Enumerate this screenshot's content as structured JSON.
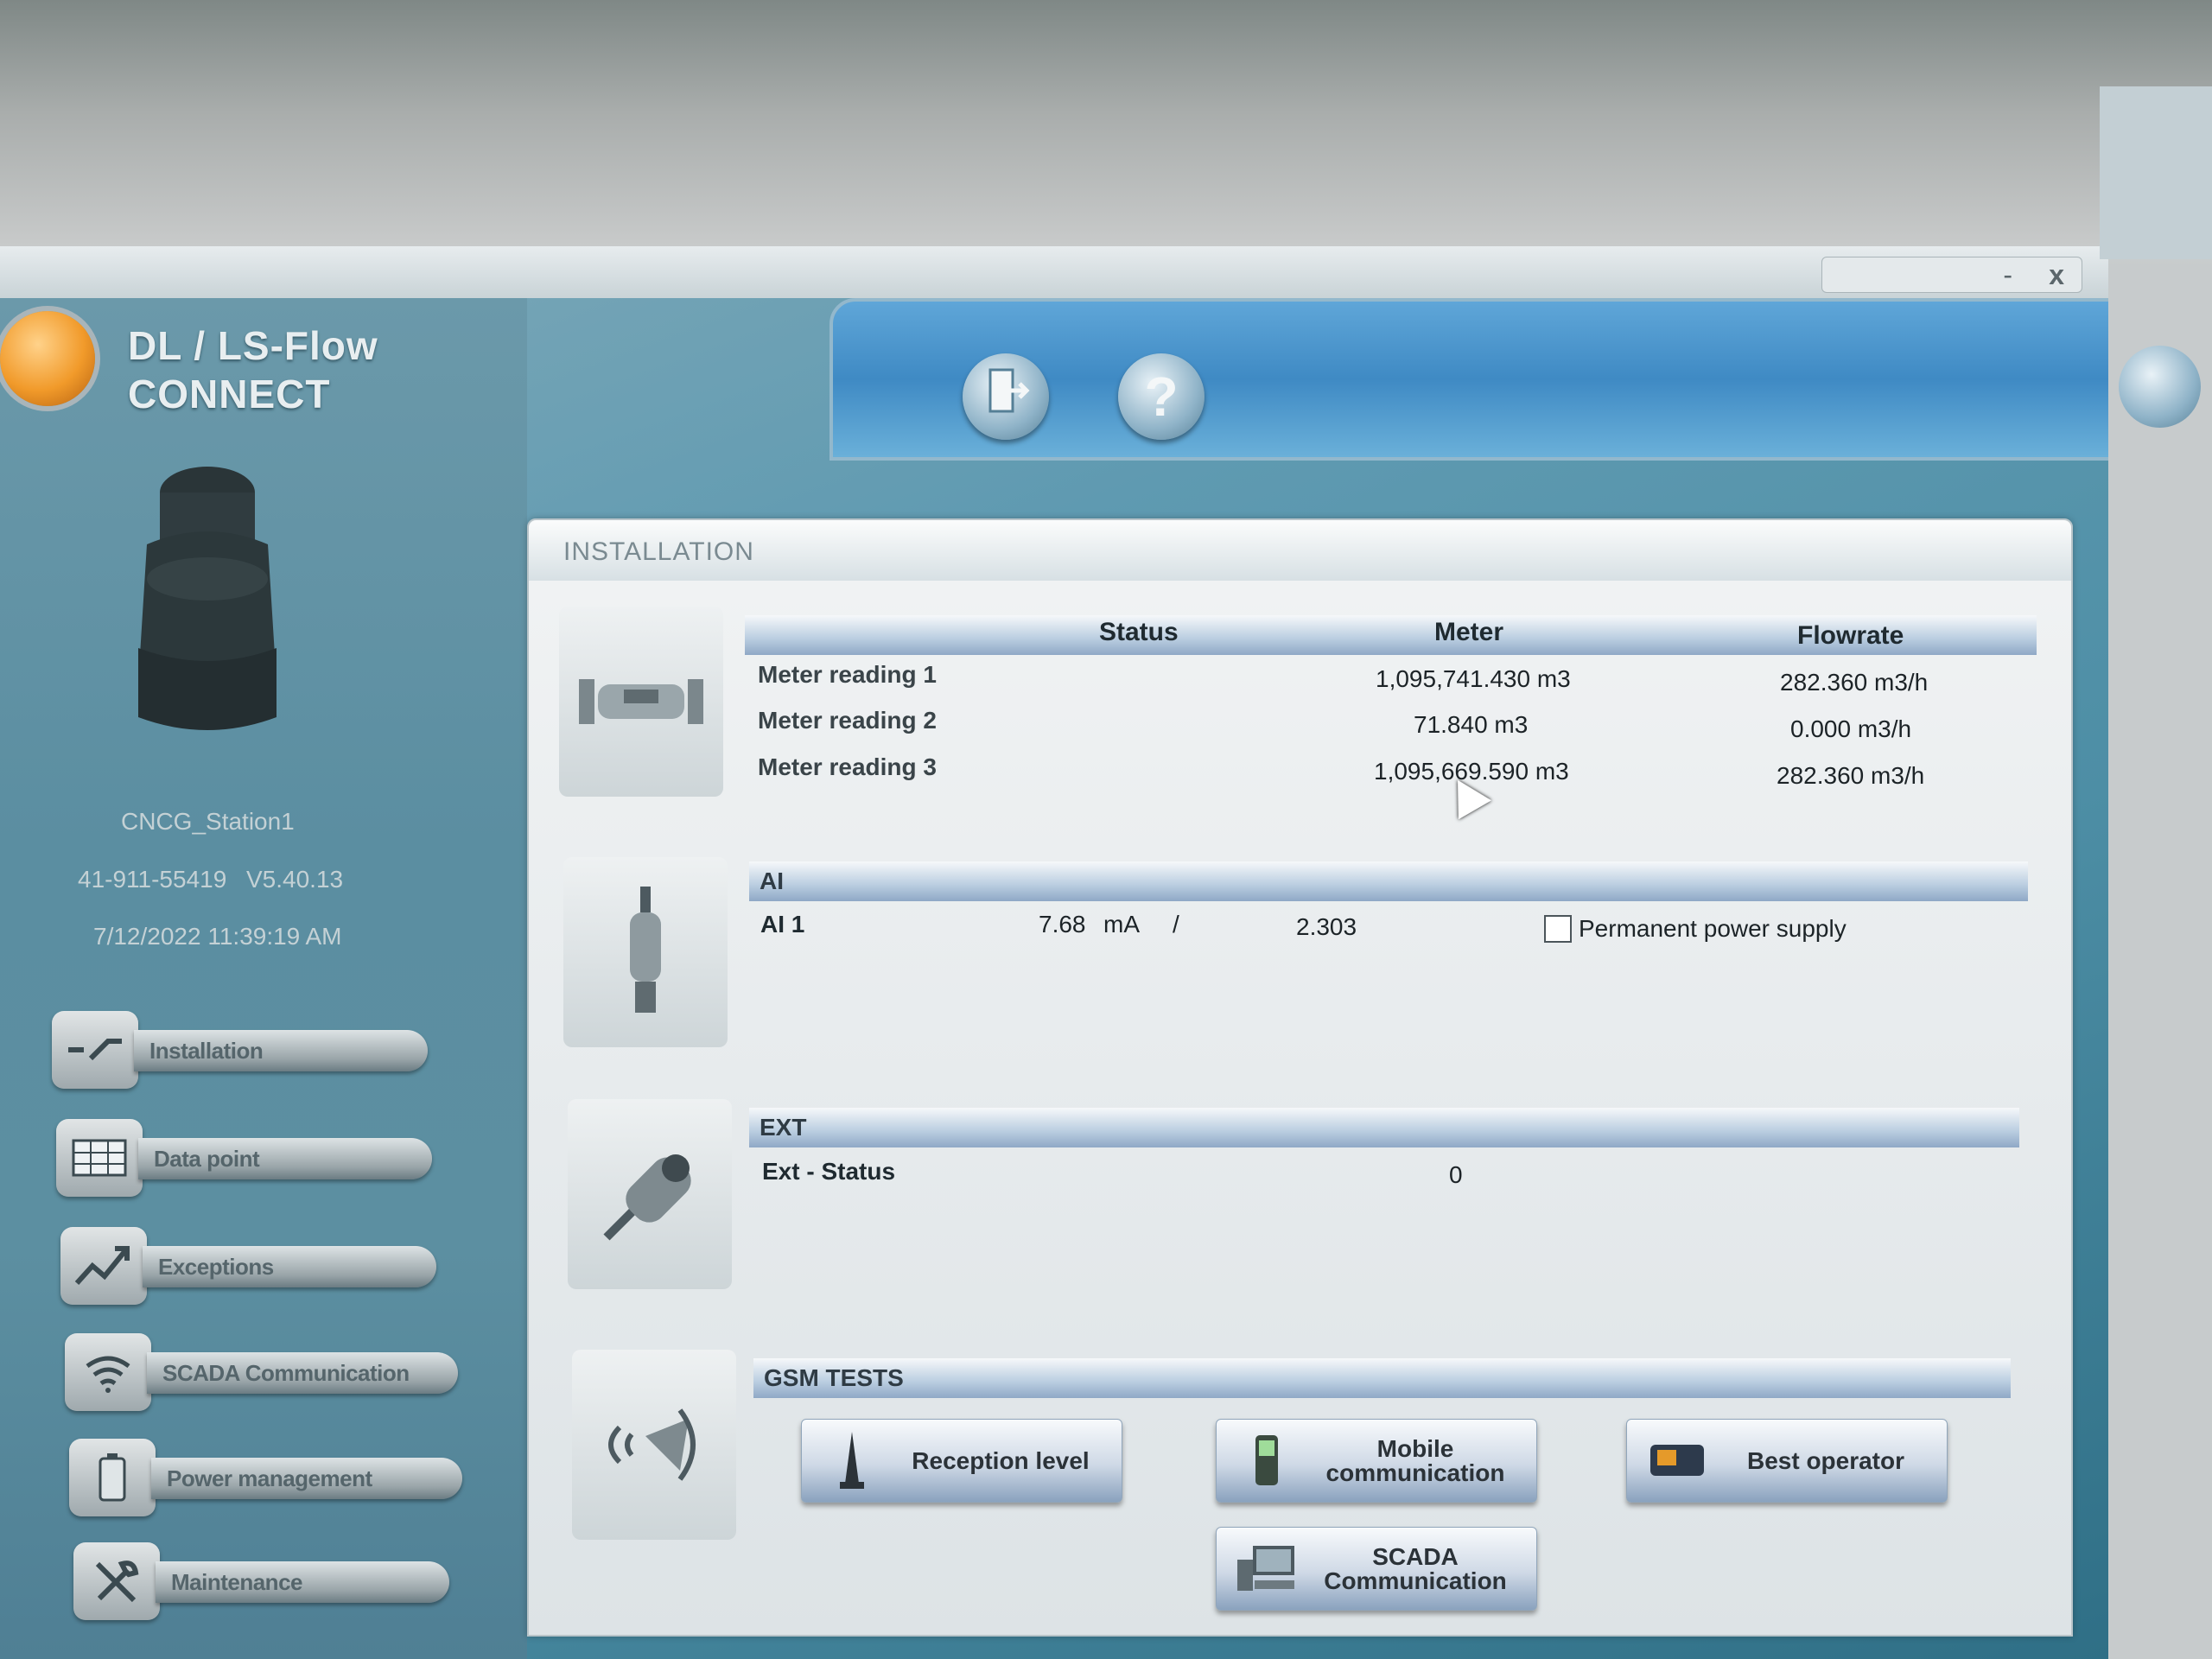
{
  "app": {
    "title_line1": "DL / LS-Flow",
    "title_line2": "CONNECT"
  },
  "window": {
    "minimize": "-",
    "close": "x"
  },
  "toolbar": {
    "exit_icon": "exit-door-icon",
    "help_label": "?"
  },
  "device": {
    "station": "CNCG_Station1",
    "serial": "41-911-55419",
    "version": "V5.40.13",
    "datetime": "7/12/2022 11:39:19 AM"
  },
  "sidebar": {
    "items": [
      {
        "label": "Installation",
        "icon": "installation-icon"
      },
      {
        "label": "Data point",
        "icon": "data-point-icon"
      },
      {
        "label": "Exceptions",
        "icon": "exceptions-icon"
      },
      {
        "label": "SCADA Communication",
        "icon": "scada-wifi-icon"
      },
      {
        "label": "Power management",
        "icon": "battery-icon"
      },
      {
        "label": "Maintenance",
        "icon": "wrench-icon"
      }
    ]
  },
  "panel": {
    "title": "INSTALLATION",
    "meters": {
      "columns": [
        "Status",
        "Meter",
        "Flowrate"
      ],
      "rows": [
        {
          "label": "Meter reading 1",
          "meter": "1,095,741.430 m3",
          "flowrate": "282.360 m3/h"
        },
        {
          "label": "Meter reading 2",
          "meter": "71.840 m3",
          "flowrate": "0.000 m3/h"
        },
        {
          "label": "Meter reading 3",
          "meter": "1,095,669.590 m3",
          "flowrate": "282.360 m3/h"
        }
      ]
    },
    "ai": {
      "header": "AI",
      "label": "AI 1",
      "value": "7.68",
      "unit": "mA",
      "separator": "/",
      "scaled": "2.303",
      "checkbox_label": "Permanent power supply",
      "checkbox_checked": false
    },
    "ext": {
      "header": "EXT",
      "label": "Ext - Status",
      "value": "0"
    },
    "gsm": {
      "header": "GSM TESTS",
      "buttons": [
        {
          "label": "Reception level",
          "icon": "antenna-icon"
        },
        {
          "label": "Mobile communication",
          "icon": "mobile-phone-icon"
        },
        {
          "label": "Best operator",
          "icon": "sim-card-icon"
        },
        {
          "label": "SCADA Communication",
          "icon": "computer-icon"
        }
      ]
    }
  }
}
